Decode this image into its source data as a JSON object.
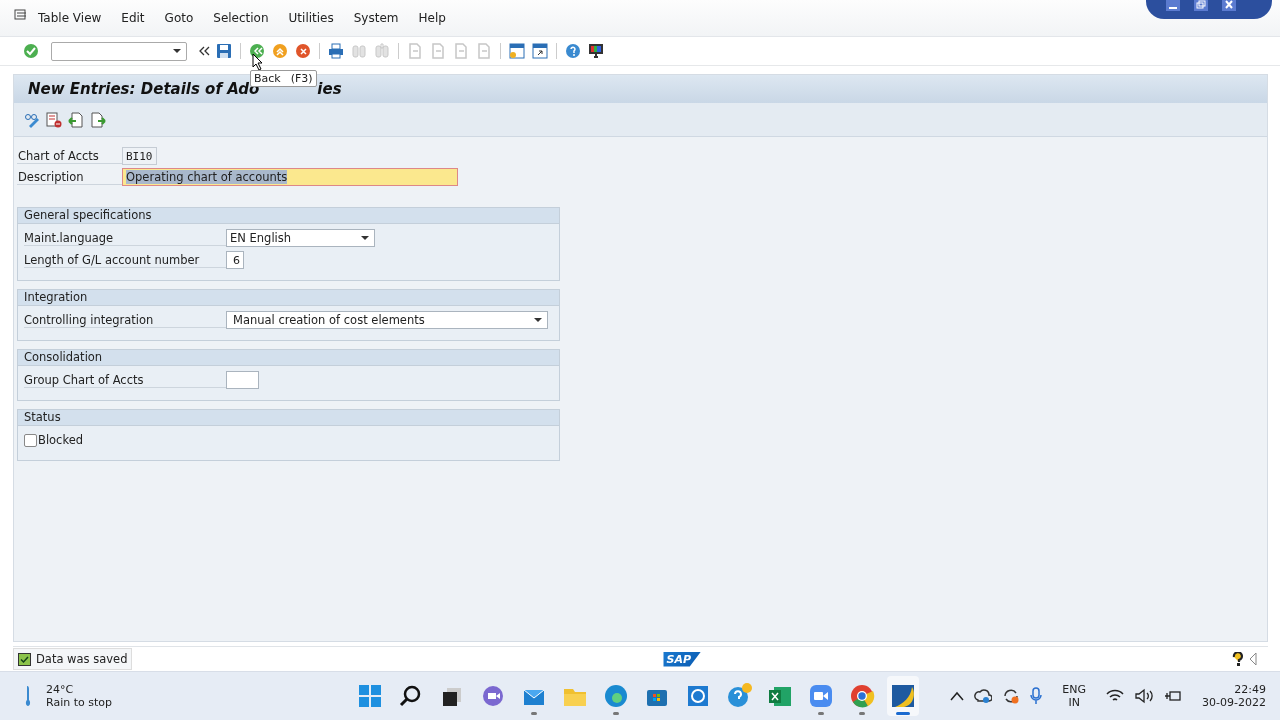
{
  "menu": [
    {
      "label": "Table View"
    },
    {
      "label": "Edit"
    },
    {
      "label": "Goto"
    },
    {
      "label": "Selection"
    },
    {
      "label": "Utilities"
    },
    {
      "label": "System"
    },
    {
      "label": "Help"
    }
  ],
  "toolbar": [
    {
      "kind": "enter",
      "disabled": false
    },
    {
      "kind": "command"
    },
    {
      "kind": "chevron"
    },
    {
      "kind": "save",
      "disabled": false
    },
    {
      "kind": "sep"
    },
    {
      "kind": "back",
      "disabled": false
    },
    {
      "kind": "exit",
      "disabled": false
    },
    {
      "kind": "cancel",
      "disabled": false
    },
    {
      "kind": "sep"
    },
    {
      "kind": "print",
      "disabled": false
    },
    {
      "kind": "find",
      "disabled": true
    },
    {
      "kind": "findnext",
      "disabled": true
    },
    {
      "kind": "sep"
    },
    {
      "kind": "page",
      "disabled": true
    },
    {
      "kind": "page",
      "disabled": true
    },
    {
      "kind": "page",
      "disabled": true
    },
    {
      "kind": "page",
      "disabled": true
    },
    {
      "kind": "sep"
    },
    {
      "kind": "newsession",
      "disabled": false
    },
    {
      "kind": "shortcut",
      "disabled": false
    },
    {
      "kind": "sep"
    },
    {
      "kind": "help",
      "disabled": false
    },
    {
      "kind": "layout",
      "disabled": false
    }
  ],
  "tooltip": {
    "text": "Back",
    "key": "(F3)"
  },
  "title": {
    "parts": [
      "New Entries: Details of Ado",
      "ies"
    ]
  },
  "header_fields": [
    {
      "label": "Chart of Accts",
      "value": "BI10",
      "kind": "short",
      "highlighted": false
    },
    {
      "label": "Description",
      "value": "Operating chart of accounts",
      "kind": "long",
      "highlighted": true
    }
  ],
  "groups": [
    {
      "title": "General specifications",
      "rows": [
        {
          "label": "Maint.language",
          "kind": "dropdown",
          "value": "EN English"
        },
        {
          "label": "Length of G/L account number",
          "kind": "digit",
          "value": "6"
        }
      ]
    },
    {
      "title": "Integration",
      "rows": [
        {
          "label": "Controlling integration",
          "kind": "widedropdown",
          "value": "Manual creation of cost elements"
        }
      ]
    },
    {
      "title": "Consolidation",
      "rows": [
        {
          "label": "Group Chart of Accts",
          "kind": "input"
        }
      ]
    },
    {
      "title": "Status",
      "rows": [
        {
          "label": "Blocked",
          "kind": "checkbox",
          "checked": false
        }
      ]
    }
  ],
  "status_bar": {
    "message": "Data was saved",
    "kind": "success",
    "logo": "SAP"
  },
  "taskbar": {
    "weather": {
      "temp": "24°C",
      "text": "Rain to stop"
    },
    "apps": [
      {
        "kind": "start",
        "running": false,
        "selected": false
      },
      {
        "kind": "search",
        "running": false,
        "selected": false
      },
      {
        "kind": "taskview",
        "running": false,
        "selected": false
      },
      {
        "kind": "chat",
        "running": false,
        "selected": false
      },
      {
        "kind": "mail",
        "running": true,
        "selected": false
      },
      {
        "kind": "folder",
        "running": false,
        "selected": false
      },
      {
        "kind": "edge",
        "running": true,
        "selected": false
      },
      {
        "kind": "store",
        "running": false,
        "selected": false
      },
      {
        "kind": "app",
        "running": false,
        "selected": false
      },
      {
        "kind": "helpapp",
        "running": false,
        "selected": false
      },
      {
        "kind": "excel",
        "running": false,
        "selected": false
      },
      {
        "kind": "video",
        "running": true,
        "selected": false
      },
      {
        "kind": "chrome",
        "running": true,
        "selected": false
      },
      {
        "kind": "sap",
        "running": true,
        "selected": true
      }
    ],
    "lang": [
      "ENG",
      "IN"
    ],
    "time": "22:49",
    "date": "30-09-2022"
  }
}
